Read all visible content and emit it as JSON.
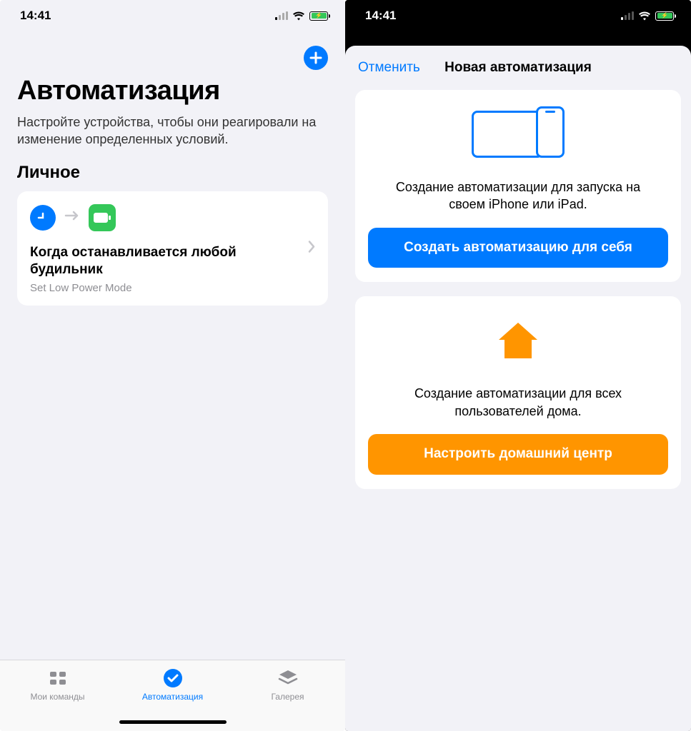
{
  "status": {
    "time": "14:41"
  },
  "left": {
    "title": "Автоматизация",
    "subtitle": "Настройте устройства, чтобы они реагировали на изменение определенных условий.",
    "section": "Личное",
    "automation": {
      "title": "Когда останавливается любой будильник",
      "subtitle": "Set Low Power Mode"
    },
    "tabs": {
      "my_shortcuts": "Мои команды",
      "automation": "Автоматизация",
      "gallery": "Галерея"
    }
  },
  "right": {
    "cancel": "Отменить",
    "title": "Новая автоматизация",
    "personal": {
      "text": "Создание автоматизации для запуска на своем iPhone или iPad.",
      "button": "Создать автоматизацию для себя"
    },
    "home": {
      "text": "Создание автоматизации для всех пользователей дома.",
      "button": "Настроить домашний центр"
    }
  }
}
